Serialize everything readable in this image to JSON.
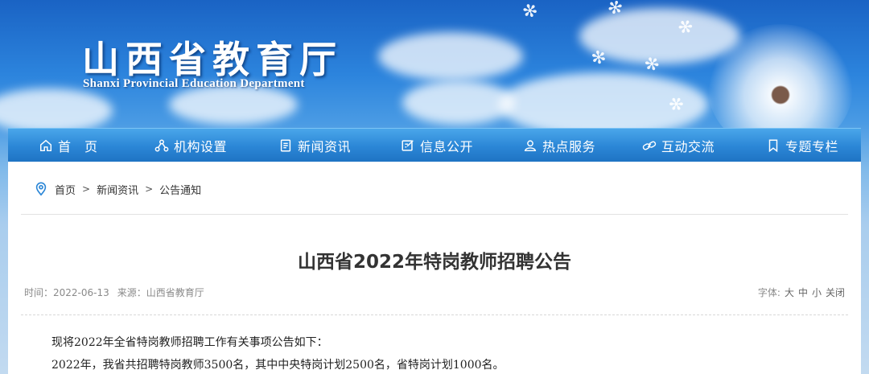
{
  "header": {
    "site_name_cn": "山西省教育厅",
    "site_name_en": "Shanxi Provincial Education Department"
  },
  "nav": {
    "items": [
      {
        "label": "首　页",
        "icon": "home-icon"
      },
      {
        "label": "机构设置",
        "icon": "org-chart-icon"
      },
      {
        "label": "新闻资讯",
        "icon": "document-icon"
      },
      {
        "label": "信息公开",
        "icon": "edit-icon"
      },
      {
        "label": "热点服务",
        "icon": "user-icon"
      },
      {
        "label": "互动交流",
        "icon": "link-icon"
      },
      {
        "label": "专题专栏",
        "icon": "bookmark-icon"
      }
    ]
  },
  "breadcrumb": {
    "icon": "location-pin-icon",
    "items": [
      "首页",
      "新闻资讯",
      "公告通知"
    ],
    "separator": ">"
  },
  "article": {
    "title": "山西省2022年特岗教师招聘公告",
    "time": "时间：2022-06-13",
    "source": "来源：山西省教育厅",
    "font_label": "字体:",
    "font_large": "大",
    "font_medium": "中",
    "font_small": "小",
    "close": "关闭",
    "paragraphs": [
      "现将2022年全省特岗教师招聘工作有关事项公告如下：",
      "2022年，我省共招聘特岗教师3500名，其中中央特岗计划2500名，省特岗计划1000名。"
    ]
  },
  "colors": {
    "nav_top": "#4aa6ea",
    "nav_bottom": "#1f74c4",
    "title_text": "#333333",
    "meta_text": "#8a8a8a"
  }
}
